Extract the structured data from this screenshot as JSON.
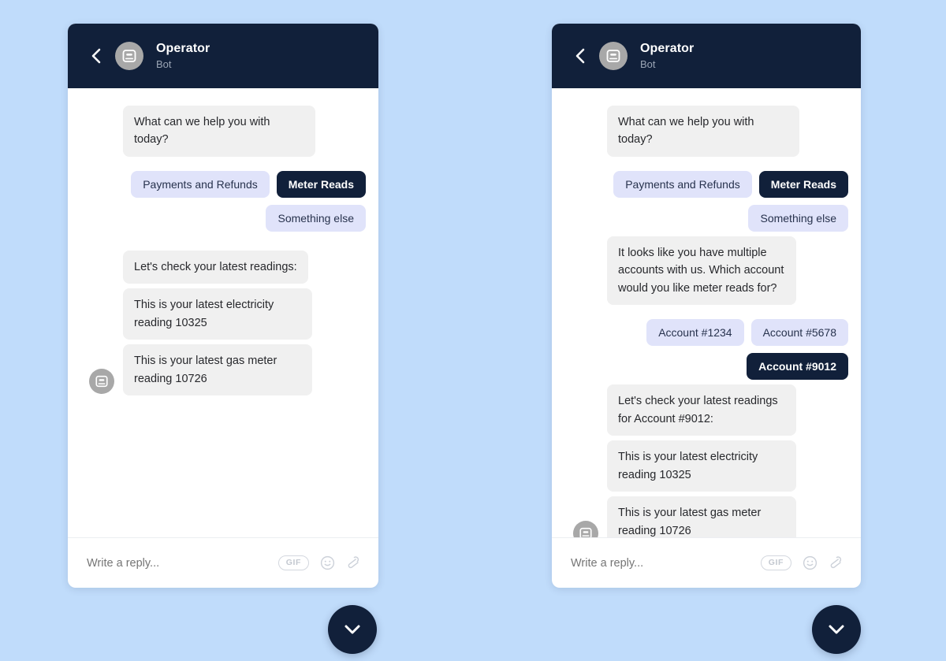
{
  "background_color": "#c0dcfb",
  "theme": {
    "dark_navy": "#11203a",
    "chip_bg": "#e0e3fa",
    "bubble_bg": "#f0f0f0",
    "avatar_gray": "#a8a8a8"
  },
  "header": {
    "back_icon": "chevron-left-icon",
    "avatar_icon": "bot-icon",
    "title": "Operator",
    "subtitle": "Bot"
  },
  "composer": {
    "placeholder": "Write a reply...",
    "gif_label": "GIF",
    "emoji_icon": "smiley-icon",
    "attach_icon": "paperclip-icon"
  },
  "launcher": {
    "icon": "chevron-down-icon"
  },
  "panels": [
    {
      "id": "single-account",
      "messages": [
        {
          "text": "What can we help you with today?"
        }
      ],
      "chips": [
        {
          "label": "Payments and Refunds",
          "selected": false
        },
        {
          "label": "Meter Reads",
          "selected": true
        },
        {
          "label": "Something else",
          "selected": false
        }
      ],
      "replies": [
        {
          "text": "Let's check your latest readings:"
        },
        {
          "text": "This is your latest electricity reading 10325"
        },
        {
          "text": "This is your latest gas meter reading 10726"
        }
      ]
    },
    {
      "id": "multi-account",
      "messages": [
        {
          "text": "What can we help you with today?"
        }
      ],
      "chips": [
        {
          "label": "Payments and Refunds",
          "selected": false
        },
        {
          "label": "Meter Reads",
          "selected": true
        },
        {
          "label": "Something else",
          "selected": false
        }
      ],
      "prompt": {
        "text": "It looks like you have multiple accounts with us. Which account would you like meter reads for?"
      },
      "account_chips": [
        {
          "label": "Account #1234",
          "selected": false
        },
        {
          "label": "Account #5678",
          "selected": false
        },
        {
          "label": "Account #9012",
          "selected": true
        }
      ],
      "replies": [
        {
          "text": "Let's check your latest readings for Account #9012:"
        },
        {
          "text": "This is your latest electricity reading 10325"
        },
        {
          "text": "This is your latest gas meter reading 10726"
        }
      ]
    }
  ]
}
